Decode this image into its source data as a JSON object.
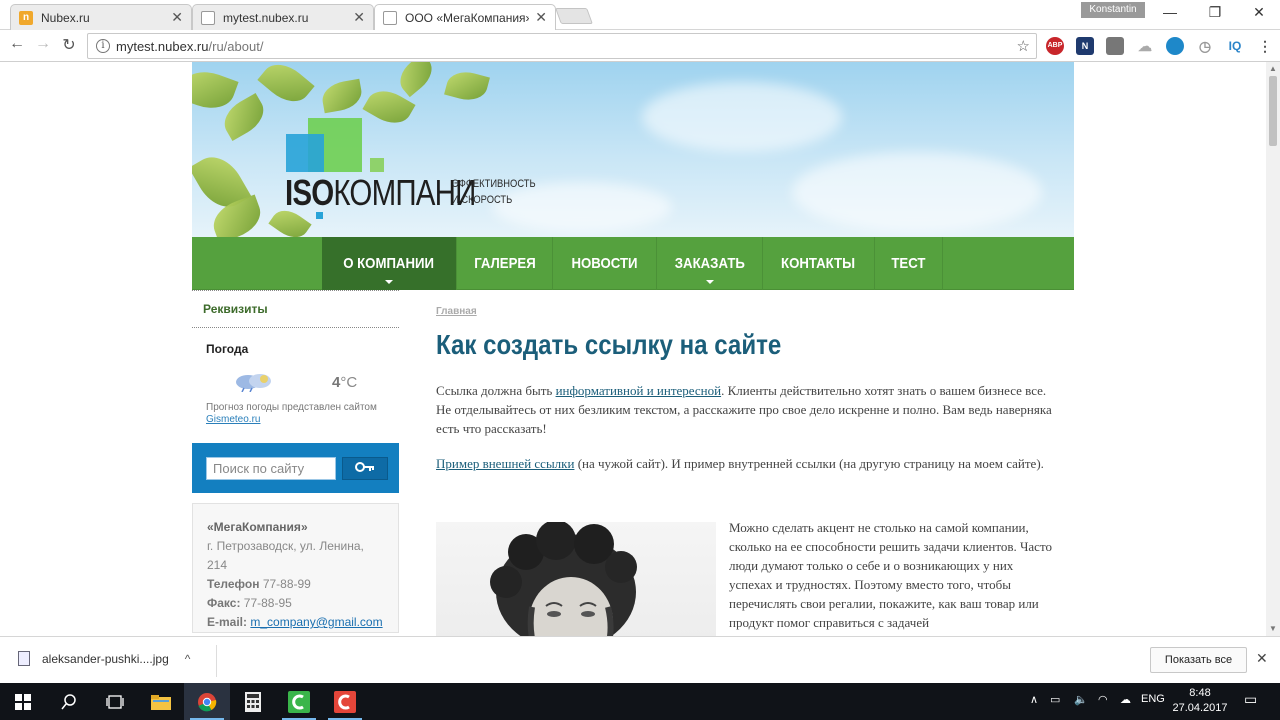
{
  "browser": {
    "tabs": [
      {
        "title": "Nubex.ru",
        "favicon": "nubex-icon"
      },
      {
        "title": "mytest.nubex.ru",
        "favicon": "page-icon"
      },
      {
        "title": "ООО «МегаКомпания»",
        "favicon": "page-icon"
      }
    ],
    "profile_name": "Konstantin",
    "url_host": "mytest.nubex.ru",
    "url_path": "/ru/about/",
    "extensions": [
      "ABP",
      "N",
      "",
      "",
      "",
      "",
      "IQ"
    ]
  },
  "site": {
    "logo_bold": "ISO",
    "logo_rest": "КОМПАНИ",
    "logo_tagline_1": "ЭФФЕКТИВНОСТЬ",
    "logo_tagline_2": "И СКОРОСТЬ",
    "nav": [
      {
        "label": "О компании",
        "has_submenu": true,
        "active": true
      },
      {
        "label": "Галерея",
        "has_submenu": false,
        "active": false
      },
      {
        "label": "Новости",
        "has_submenu": false,
        "active": false
      },
      {
        "label": "Заказать",
        "has_submenu": true,
        "active": false
      },
      {
        "label": "Контакты",
        "has_submenu": false,
        "active": false
      },
      {
        "label": "Тест",
        "has_submenu": false,
        "active": false
      }
    ],
    "colors": {
      "nav_green": "#55a13e",
      "nav_active": "#36702a",
      "title_blue": "#1b5e7a",
      "search_blue": "#137fc0"
    }
  },
  "sidebar": {
    "link": "Реквизиты",
    "weather": {
      "title": "Погода",
      "temp_value": "4",
      "temp_unit": "°C",
      "note": "Прогноз погоды представлен сайтом",
      "provider": "Gismeteo.ru"
    },
    "search": {
      "placeholder": "Поиск по сайту",
      "button_icon": "key-icon"
    },
    "contacts": {
      "company": "«МегаКомпания»",
      "address": "г. Петрозаводск, ул. Ленина, 214",
      "phone_label": "Телефон",
      "phone": "77-88-99",
      "fax_label": "Факс:",
      "fax": "77-88-95",
      "email_label": "E-mail:",
      "email": "m_company@gmail.com"
    }
  },
  "content": {
    "breadcrumb": "Главная",
    "title": "Как создать ссылку на сайте",
    "p1_before": "Ссылка должна быть ",
    "p1_link": "информативной и интересной",
    "p1_after": ". Клиенты действительно хотят знать о вашем бизнесе все. Не отделывайтесь от них безликим текстом, а расскажите про свое дело искренне и полно. Вам ведь наверняка есть что рассказать!",
    "p2_link": "Пример внешней ссылки",
    "p2_after": " (на чужой сайт). И пример внутренней ссылки (на другую страницу на моем сайте).",
    "p3": "Можно сделать акцент не столько на самой компании, сколько на ее способности решить задачи клиентов. Часто люди думают только о себе и о возникающих у них успехах и трудностях. Поэтому вместо того, чтобы перечислять свои регалии, покажите, как ваш товар или продукт помог справиться с задачей"
  },
  "downloads": {
    "file_name": "aleksander-pushki....jpg",
    "show_all": "Показать все"
  },
  "taskbar": {
    "lang": "ENG",
    "time": "8:48",
    "date": "27.04.2017"
  }
}
